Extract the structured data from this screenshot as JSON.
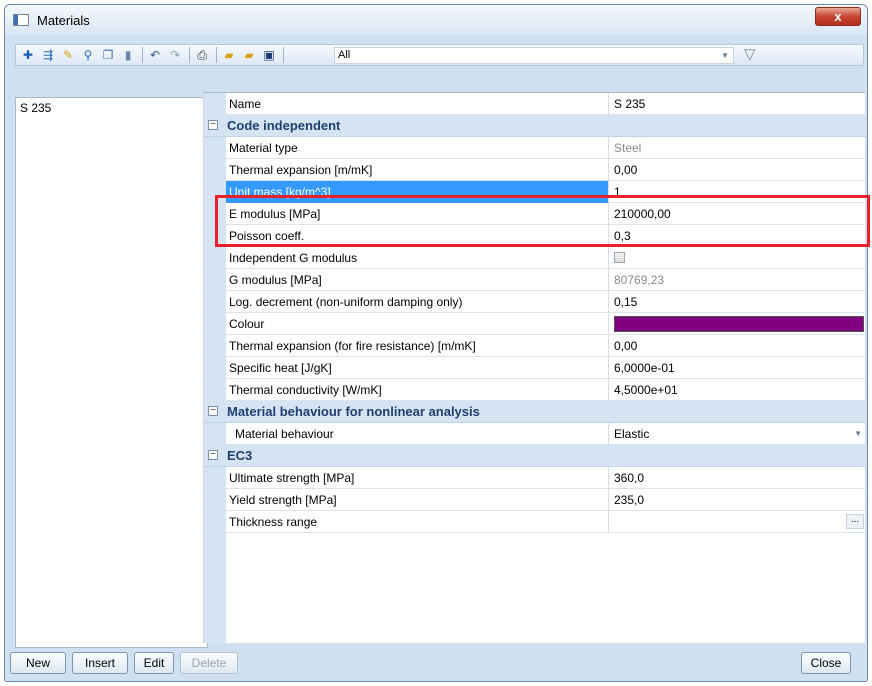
{
  "window": {
    "title": "Materials",
    "close_glyph": "x"
  },
  "toolbar": {
    "filter_value": "All",
    "icons": [
      "new-icon",
      "insert-icon",
      "edit-icon",
      "find-icon",
      "copy-icon",
      "paste-icon",
      "undo-icon",
      "redo-icon",
      "print-icon",
      "open-icon",
      "export-icon",
      "save-icon"
    ]
  },
  "list": {
    "items": [
      "S 235"
    ]
  },
  "grid": {
    "name_label": "Name",
    "name_value": "S 235",
    "sections": {
      "code_independent": "Code independent",
      "nonlinear": "Material behaviour for nonlinear analysis",
      "ec3": "EC3"
    },
    "rows": {
      "material_type": {
        "label": "Material type",
        "value": "Steel"
      },
      "thermal_expansion": {
        "label": "Thermal expansion  [m/mK]",
        "value": "0,00"
      },
      "unit_mass": {
        "label": "Unit mass [kg/m^3]",
        "value": "1"
      },
      "e_modulus": {
        "label": "E modulus [MPa]",
        "value": "210000,00"
      },
      "poisson": {
        "label": "Poisson coeff.",
        "value": "0,3"
      },
      "independent_g": {
        "label": "Independent G modulus",
        "checked": false
      },
      "g_modulus": {
        "label": "G modulus [MPa]",
        "value": "80769,23"
      },
      "log_decrement": {
        "label": "Log. decrement (non-uniform damping only)",
        "value": "0,15"
      },
      "colour": {
        "label": "Colour",
        "value_color": "#800080"
      },
      "thermal_expansion_fire": {
        "label": "Thermal expansion (for fire resistance)  [m/mK]",
        "value": "0,00"
      },
      "specific_heat": {
        "label": "Specific heat [J/gK]",
        "value": "6,0000e-01"
      },
      "thermal_conductivity": {
        "label": "Thermal conductivity [W/mK]",
        "value": "4,5000e+01"
      },
      "material_behaviour": {
        "label": "Material behaviour",
        "value": "Elastic"
      },
      "ultimate_strength": {
        "label": "Ultimate strength [MPa]",
        "value": "360,0"
      },
      "yield_strength": {
        "label": "Yield strength [MPa]",
        "value": "235,0"
      },
      "thickness_range": {
        "label": "Thickness range",
        "value": "",
        "button": "..."
      }
    }
  },
  "buttons": {
    "new": "New",
    "insert": "Insert",
    "edit": "Edit",
    "delete": "Delete",
    "close": "Close"
  },
  "colors": {
    "selection": "#3399ff",
    "highlight_box": "#e8202a",
    "section_header": "#1f3f70"
  }
}
